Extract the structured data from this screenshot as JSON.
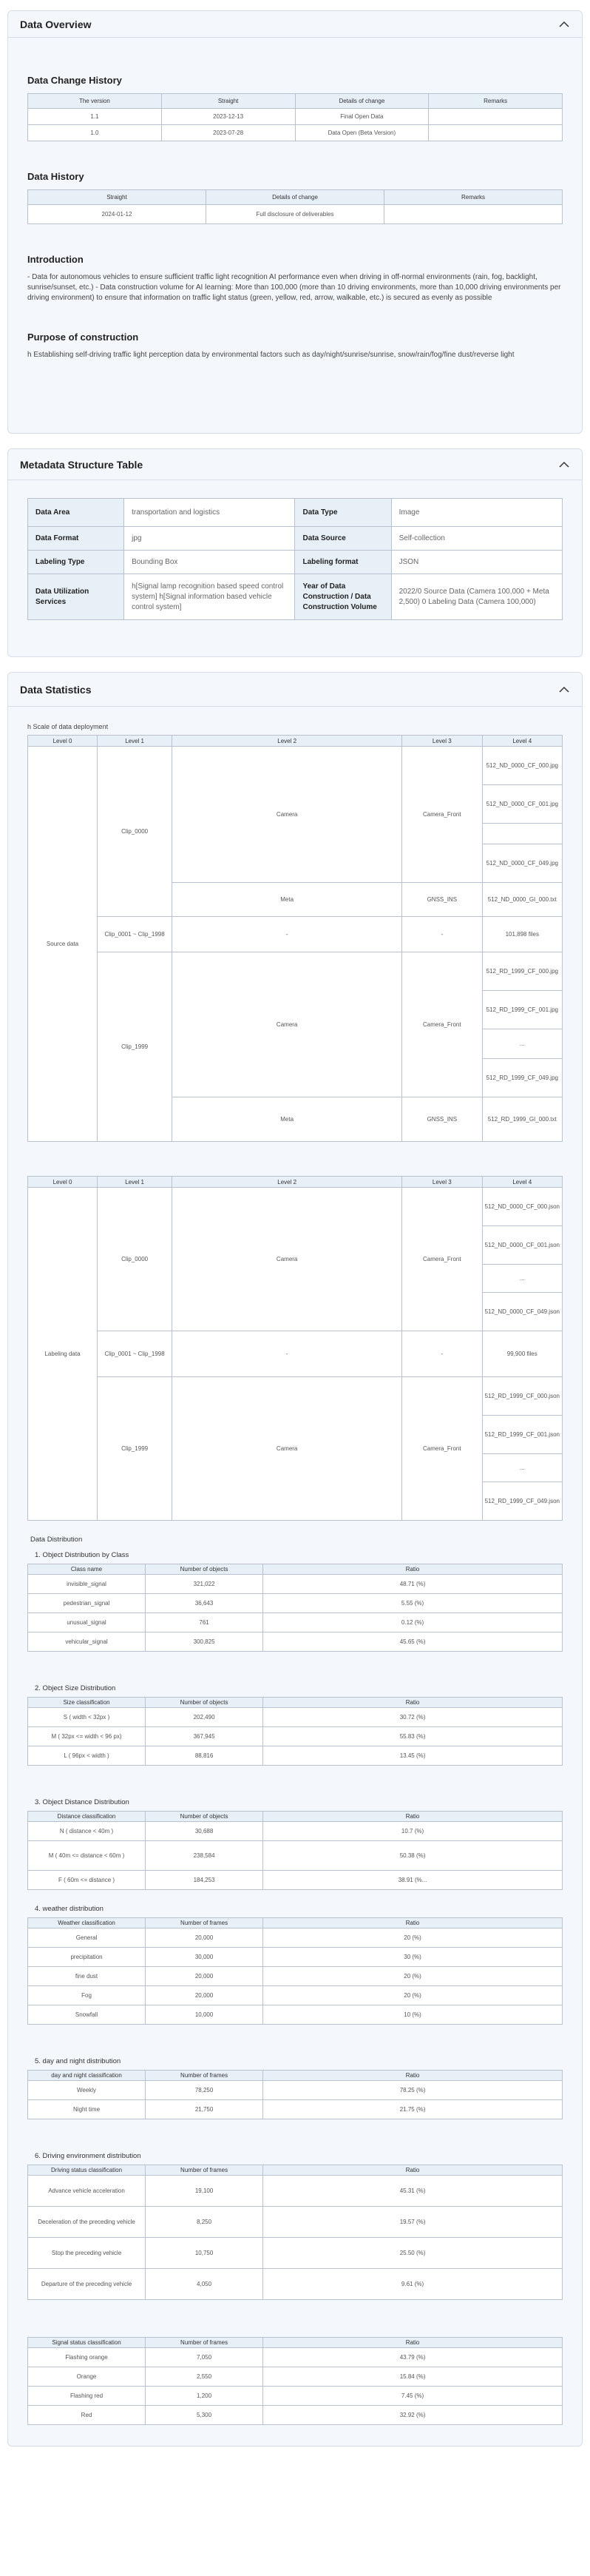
{
  "overview": {
    "title": "Data Overview",
    "change_history": {
      "heading": "Data Change History",
      "columns": [
        "The version",
        "Straight",
        "Details of change",
        "Remarks"
      ],
      "rows": [
        [
          "1.1",
          "2023-12-13",
          "Final Open Data",
          ""
        ],
        [
          "1.0",
          "2023-07-28",
          "Data Open (Beta Version)",
          ""
        ]
      ]
    },
    "data_history": {
      "heading": "Data History",
      "columns": [
        "Straight",
        "Details of change",
        "Remarks"
      ],
      "rows": [
        [
          "2024-01-12",
          "Full disclosure of deliverables",
          ""
        ]
      ]
    },
    "introduction": {
      "heading": "Introduction",
      "text": "- Data for autonomous vehicles to ensure sufficient traffic light recognition AI performance even when driving in off-normal environments (rain, fog, backlight, sunrise/sunset, etc.) - Data construction volume for AI learning: More than 100,000 (more than 10 driving environments, more than 10,000 driving environments per driving environment) to ensure that information on traffic light status (green, yellow, red, arrow, walkable, etc.) is secured as evenly as possible"
    },
    "purpose": {
      "heading": "Purpose of construction",
      "text": "h Establishing self-driving traffic light perception data by environmental factors such as day/night/sunrise/sunrise, snow/rain/fog/fine dust/reverse light"
    }
  },
  "metadata": {
    "title": "Metadata Structure Table",
    "rows": [
      {
        "k1": "Data Area",
        "v1": "transportation and logistics",
        "k2": "Data Type",
        "v2": "Image"
      },
      {
        "k1": "Data Format",
        "v1": "jpg",
        "k2": "Data Source",
        "v2": "Self-collection"
      },
      {
        "k1": "Labeling Type",
        "v1": "Bounding Box",
        "k2": "Labeling format",
        "v2": "JSON"
      },
      {
        "k1": "Data Utilization Services",
        "v1": "h[Signal lamp recognition based speed control system] h[Signal information based vehicle control system]",
        "k2": "Year of Data Construction / Data Construction Volume",
        "v2": "2022/0 Source Data (Camera 100,000 + Meta 2,500) 0 Labeling Data (Camera 100,000)"
      }
    ]
  },
  "statistics": {
    "title": "Data Statistics",
    "deploy_caption": "h Scale of data deployment",
    "levels": [
      "Level 0",
      "Level 1",
      "Level 2",
      "Level 3",
      "Level 4"
    ],
    "source": {
      "level0": "Source data",
      "clip_a": "Clip_0000",
      "clip_mid": "Clip_0001 ~ Clip_1998",
      "clip_b": "Clip_1999",
      "camera": "Camera",
      "camera_front": "Camera_Front",
      "meta": "Meta",
      "gnss": "GNSS_INS",
      "dash": "-",
      "files": "101,898 files",
      "a_files": [
        "512_ND_0000_CF_000.jpg",
        "512_ND_0000_CF_001.jpg",
        "",
        "512_ND_0000_CF_049.jpg"
      ],
      "a_meta": "512_ND_0000_GI_000.txt",
      "b_files": [
        "512_RD_1999_CF_000.jpg",
        "512_RD_1999_CF_001.jpg",
        "...",
        "512_RD_1999_CF_049.jpg"
      ],
      "b_meta": "512_RD_1999_GI_000.txt"
    },
    "labeling": {
      "level0": "Labeling data",
      "clip_a": "Clip_0000",
      "clip_mid": "Clip_0001 ~ Clip_1998",
      "clip_b": "Clip_1999",
      "camera": "Camera",
      "camera_front": "Camera_Front",
      "dash": "-",
      "files": "99,900 files",
      "a_files": [
        "512_ND_0000_CF_000.json",
        "512_ND_0000_CF_001.json",
        "...",
        "512_ND_0000_CF_049.json"
      ],
      "b_files": [
        "512_RD_1999_CF_000.json",
        "512_RD_1999_CF_001.json",
        "...",
        "512_RD_1999_CF_049.json"
      ]
    },
    "distribution_heading": "Data Distribution",
    "tables": [
      {
        "title": "1. Object Distribution by Class",
        "columns": [
          "Class name",
          "Number of objects",
          "Ratio"
        ],
        "rows": [
          [
            "invisible_signal",
            "321,022",
            "48.71 (%)"
          ],
          [
            "pedestrian_signal",
            "36,643",
            "5.55 (%)"
          ],
          [
            "unusual_signal",
            "761",
            "0.12 (%)"
          ],
          [
            "vehicular_signal",
            "300,825",
            "45.65 (%)"
          ]
        ]
      },
      {
        "title": "2. Object Size Distribution",
        "columns": [
          "Size classification",
          "Number of objects",
          "Ratio"
        ],
        "rows": [
          [
            "S ( width < 32px )",
            "202,490",
            "30.72 (%)"
          ],
          [
            "M ( 32px <= width < 96 px)",
            "367,945",
            "55.83 (%)"
          ],
          [
            "L ( 96px < width )",
            "88,816",
            "13.45 (%)"
          ]
        ]
      },
      {
        "title": "3. Object Distance Distribution",
        "columns": [
          "Distance classification",
          "Number of objects",
          "Ratio"
        ],
        "rows": [
          [
            "N ( distance < 40m )",
            "30,688",
            "10.7 (%)"
          ],
          [
            "M ( 40m <= distance < 60m )",
            "238,584",
            "50.38 (%)"
          ],
          [
            "F ( 60m <= distance )",
            "184,253",
            "38.91 (%..."
          ]
        ]
      },
      {
        "title": "4. weather distribution",
        "columns": [
          "Weather classification",
          "Number of frames",
          "Ratio"
        ],
        "rows": [
          [
            "General",
            "20,000",
            "20 (%)"
          ],
          [
            "precipitation",
            "30,000",
            "30 (%)"
          ],
          [
            "fine dust",
            "20,000",
            "20 (%)"
          ],
          [
            "Fog",
            "20,000",
            "20 (%)"
          ],
          [
            "Snowfall",
            "10,000",
            "10 (%)"
          ]
        ]
      },
      {
        "title": "5. day and night distribution",
        "columns": [
          "day and night classification",
          "Number of frames",
          "Ratio"
        ],
        "rows": [
          [
            "Weekly",
            "78,250",
            "78.25 (%)"
          ],
          [
            "Night time",
            "21,750",
            "21.75 (%)"
          ]
        ]
      },
      {
        "title": "6. Driving environment distribution",
        "columns": [
          "Driving status classification",
          "Number of frames",
          "Ratio"
        ],
        "rows": [
          [
            "Advance vehicle acceleration",
            "19,100",
            "45.31 (%)"
          ],
          [
            "Deceleration of the preceding vehicle",
            "8,250",
            "19.57 (%)"
          ],
          [
            "Stop the preceding vehicle",
            "10,750",
            "25.50 (%)"
          ],
          [
            "Departure of the preceding vehicle",
            "4,050",
            "9.61 (%)"
          ]
        ]
      },
      {
        "title": "",
        "columns": [
          "Signal status classification",
          "Number of frames",
          "Ratio"
        ],
        "rows": [
          [
            "Flashing orange",
            "7,050",
            "43.79 (%)"
          ],
          [
            "Orange",
            "2,550",
            "15.84 (%)"
          ],
          [
            "Flashing red",
            "1,200",
            "7.45 (%)"
          ],
          [
            "Red",
            "5,300",
            "32.92 (%)"
          ]
        ]
      }
    ]
  }
}
